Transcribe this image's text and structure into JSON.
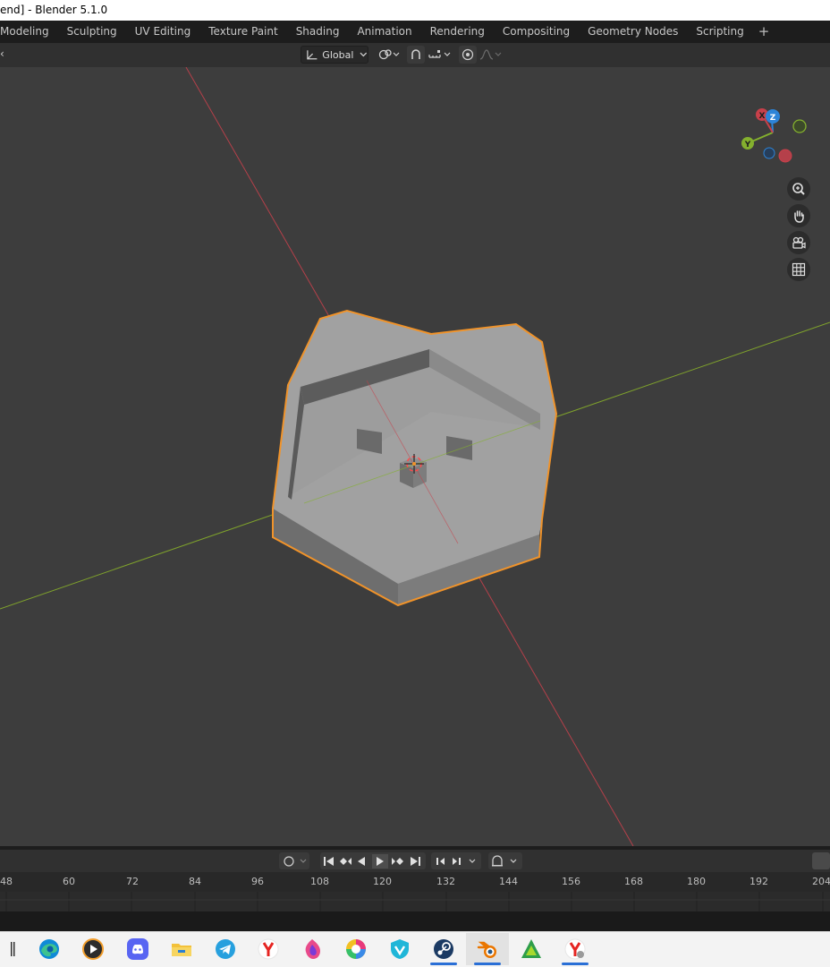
{
  "window": {
    "title": "end] - Blender 5.1.0"
  },
  "workspaces": [
    "Modeling",
    "Sculpting",
    "UV Editing",
    "Texture Paint",
    "Shading",
    "Animation",
    "Rendering",
    "Compositing",
    "Geometry Nodes",
    "Scripting"
  ],
  "workspace_add": "+",
  "viewport_header": {
    "edge_glyph": "‹",
    "transform_orientation": "Global",
    "pivot_icon": "pivot-icon",
    "snap_icon": "snap-magnet-icon",
    "snap_target_icon": "snap-increment-icon",
    "proportional_icon": "proportional-edit-icon",
    "falloff_icon": "falloff-curve-icon"
  },
  "gizmo": {
    "x_label": "X",
    "y_label": "Y",
    "z_label": "Z"
  },
  "nav_buttons": [
    "zoom-icon",
    "pan-hand-icon",
    "camera-view-icon",
    "ortho-grid-icon"
  ],
  "timeline": {
    "ruler_ticks": [
      "48",
      "60",
      "72",
      "84",
      "96",
      "108",
      "120",
      "132",
      "144",
      "156",
      "168",
      "180",
      "192",
      "204"
    ]
  },
  "taskbar": {
    "apps": [
      "task-view-icon",
      "edge-icon",
      "media-player-icon",
      "discord-icon",
      "file-explorer-icon",
      "telegram-icon",
      "yandex-browser-icon",
      "firefox-icon",
      "colorful-app-icon",
      "vpn-shield-icon",
      "steam-icon",
      "blender-icon",
      "affinity-icon",
      "yandex-music-icon"
    ]
  },
  "colors": {
    "selection_outline": "#f0932a",
    "x_axis": "#c8404a",
    "y_axis": "#84b02e",
    "mesh_face": "#9e9e9e",
    "viewport_bg": "#3d3d3d"
  }
}
